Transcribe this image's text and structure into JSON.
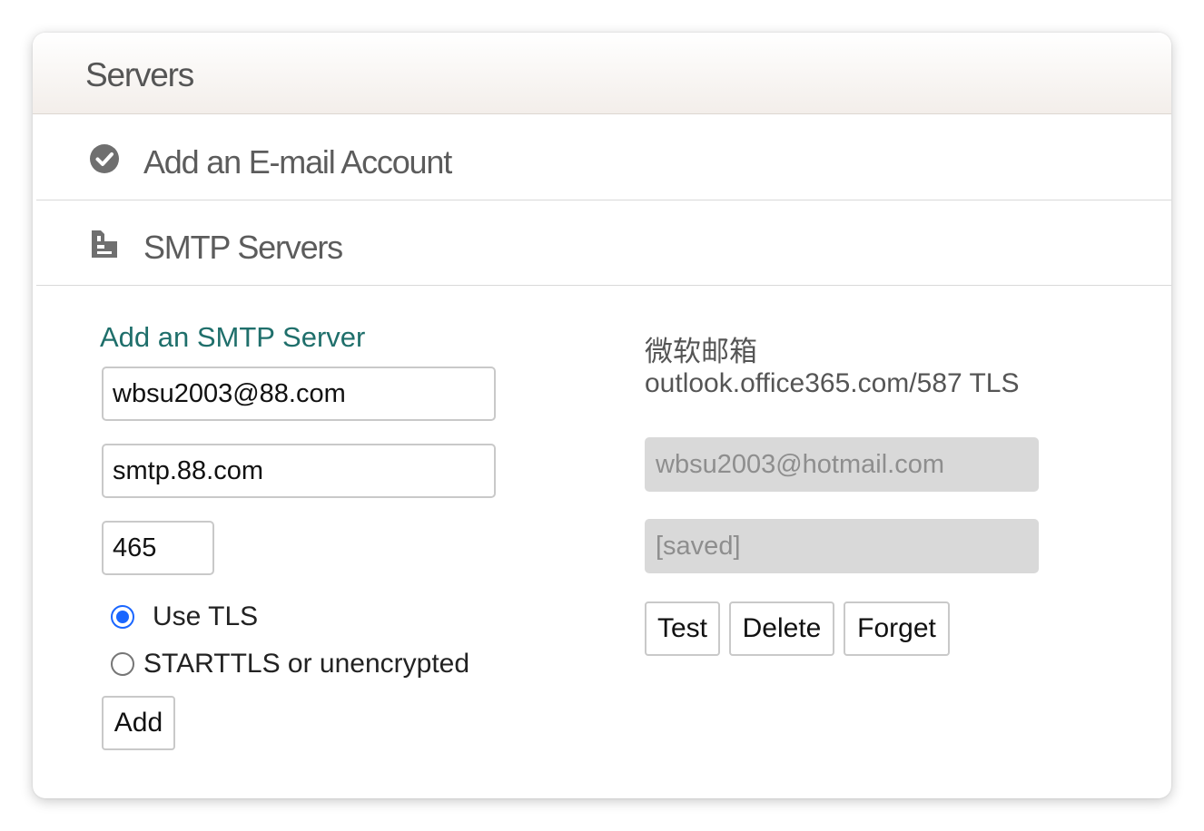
{
  "header": {
    "title": "Servers"
  },
  "sections": [
    {
      "label": "Add an E-mail Account",
      "icon": "check-circle-icon"
    },
    {
      "label": "SMTP Servers",
      "icon": "document-icon"
    }
  ],
  "add_form": {
    "title": "Add an SMTP Server",
    "email_value": "wbsu2003@88.com",
    "host_value": "smtp.88.com",
    "port_value": "465",
    "tls_label": "Use TLS",
    "starttls_label": "STARTTLS or unencrypted",
    "selected_security": "Use TLS",
    "add_label": "Add"
  },
  "server": {
    "name": "微软邮箱",
    "address": "outlook.office365.com/587 TLS",
    "username_value": "wbsu2003@hotmail.com",
    "password_value": "[saved]",
    "test_label": "Test",
    "delete_label": "Delete",
    "forget_label": "Forget"
  },
  "colors": {
    "accent_title": "#1f6f6b",
    "radio_selected": "#1a66ff",
    "disabled_field": "#d9d9d9"
  }
}
